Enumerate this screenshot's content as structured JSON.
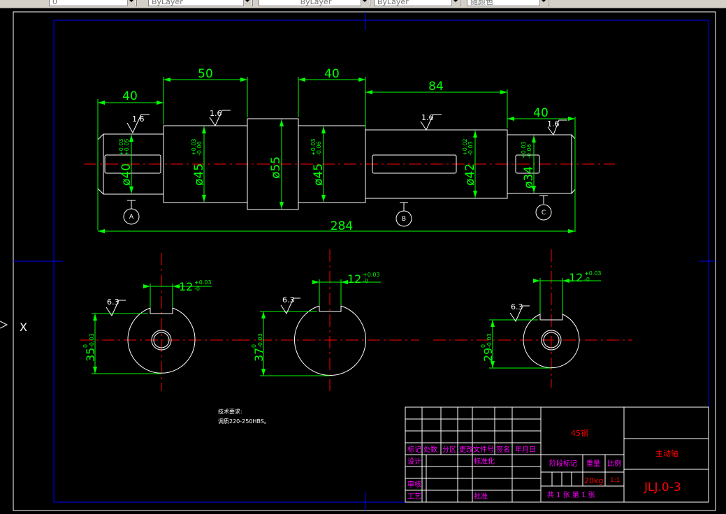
{
  "toolbar": {
    "layer_value": "0",
    "color_value": "ByLayer",
    "linetype_value": "ByLayer",
    "lineweight_value": "ByLayer",
    "plotstyle_value": "随颜色"
  },
  "ucs": {
    "axis_label": "X"
  },
  "colors": {
    "background": "#000000",
    "border": "#0000ff",
    "geometry": "#ffffff",
    "dimension": "#00ff00",
    "centerline": "#ff0000",
    "titleblock_text": "#ff00ff"
  },
  "shaft_view": {
    "dims_length": [
      "40",
      "50",
      "40",
      "84",
      "40",
      "284"
    ],
    "dims_diameter": {
      "d40": "ø40",
      "d40_tol_upper": "+0.03",
      "d40_tol_lower": "+0.05",
      "d45a": "ø45",
      "d45a_tol_upper": "+0.03",
      "d45a_tol_lower": "-0.06",
      "d55": "ø55",
      "d45b": "ø45",
      "d45b_tol_upper": "+0.03",
      "d45b_tol_lower": "-0.06",
      "d42": "ø42",
      "d42_tol_upper": "+0.02",
      "d42_tol_lower": "-0.03",
      "d34": "ø34",
      "d34_tol_upper": "+0.03",
      "d34_tol_lower": "-0.06"
    },
    "roughness": [
      "1.6",
      "1.6",
      "1.6",
      "1.6"
    ],
    "datums": [
      "A",
      "B",
      "C"
    ]
  },
  "sections": [
    {
      "key_width": "12",
      "key_tol_upper": "+0.03",
      "key_tol_lower": "-0",
      "depth": "35",
      "depth_tol_upper": "0",
      "depth_tol_lower": "-0.03",
      "roughness": "6.3"
    },
    {
      "key_width": "12",
      "key_tol_upper": "+0.03",
      "key_tol_lower": "-0",
      "depth": "37",
      "depth_tol_upper": "0",
      "depth_tol_lower": "-0.03",
      "roughness": "6.3"
    },
    {
      "key_width": "12",
      "key_tol_upper": "+0.03",
      "key_tol_lower": "-0",
      "depth": "29",
      "depth_tol_upper": "0",
      "depth_tol_lower": "-0.03",
      "roughness": "6.3"
    }
  ],
  "tech_notes": {
    "title": "技术要求:",
    "line1": "调质220-250HBS。"
  },
  "title_block": {
    "material": "45钢",
    "part_name": "主动轴",
    "drawing_number": "JLJ.0-3",
    "mark": "标记",
    "count": "处数",
    "zone": "分区",
    "change_doc": "更改文件号",
    "sign": "签名",
    "date": "年月日",
    "design": "设计",
    "standardize": "标准化",
    "stage_mark": "阶段标记",
    "weight": "重量",
    "scale": "比例",
    "weight_value": "20kg",
    "scale_value": "1:1",
    "review": "审核",
    "process": "工艺",
    "approve": "批准",
    "sheets": "共 1 张 第 1 张"
  }
}
